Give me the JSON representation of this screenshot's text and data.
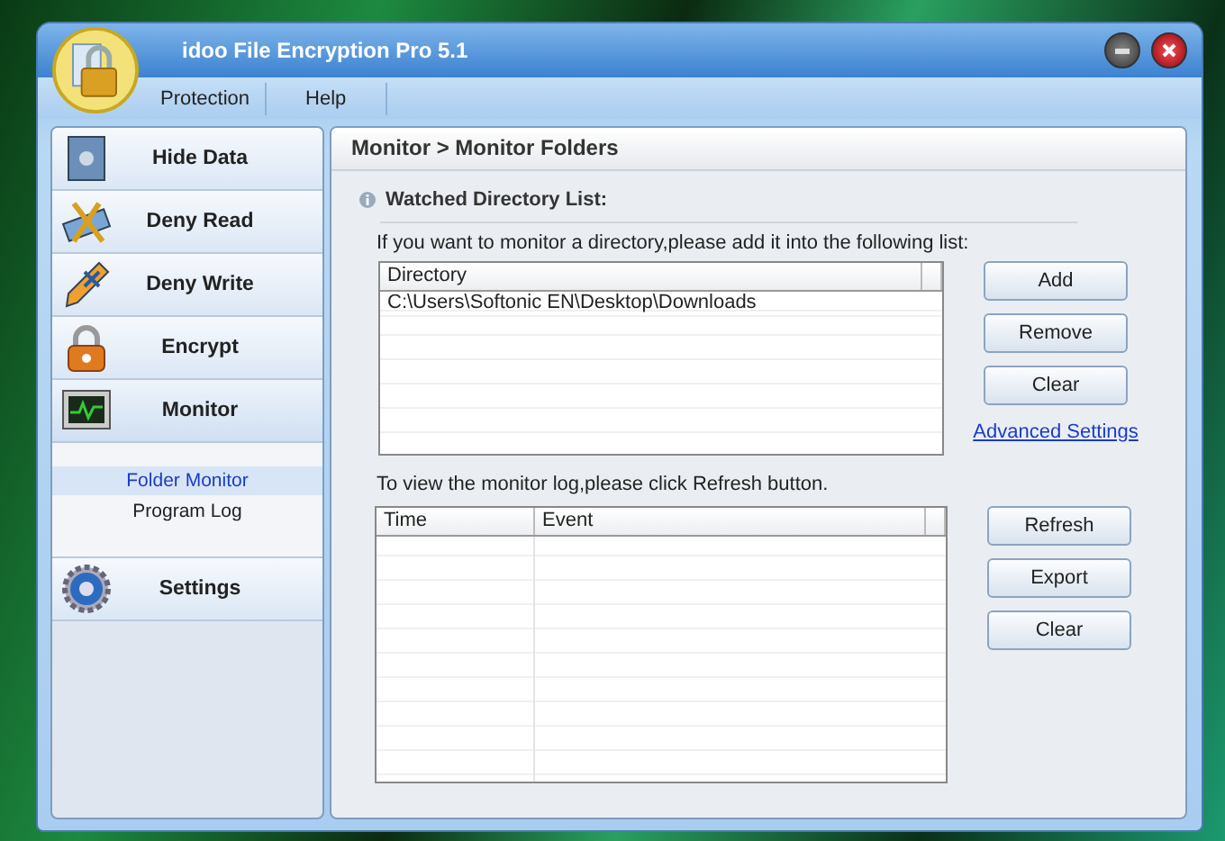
{
  "window": {
    "title": "idoo File Encryption Pro 5.1"
  },
  "menu": [
    {
      "label": "Protection"
    },
    {
      "label": "Help"
    }
  ],
  "sidebar": {
    "items": [
      {
        "label": "Hide Data",
        "expanded": false
      },
      {
        "label": "Deny Read",
        "expanded": false
      },
      {
        "label": "Deny Write",
        "expanded": false
      },
      {
        "label": "Encrypt",
        "expanded": false
      },
      {
        "label": "Monitor",
        "expanded": true,
        "children": [
          {
            "label": "Folder Monitor",
            "selected": true
          },
          {
            "label": "Program Log",
            "selected": false
          }
        ]
      },
      {
        "label": "Settings",
        "expanded": false
      }
    ]
  },
  "content": {
    "breadcrumb": "Monitor > Monitor Folders",
    "section_title": "Watched Directory List:",
    "directory_hint": "If you want to monitor a directory,please add it into the following list:",
    "directory_table": {
      "columns": [
        "Directory"
      ],
      "rows": [
        [
          "C:\\Users\\Softonic EN\\Desktop\\Downloads"
        ]
      ]
    },
    "directory_buttons": [
      "Add",
      "Remove",
      "Clear"
    ],
    "advanced_link": "Advanced Settings",
    "log_hint": "To view the monitor log,please click Refresh button.",
    "log_table": {
      "columns": [
        "Time",
        "Event"
      ]
    },
    "log_buttons": [
      "Refresh",
      "Export",
      "Clear"
    ]
  }
}
